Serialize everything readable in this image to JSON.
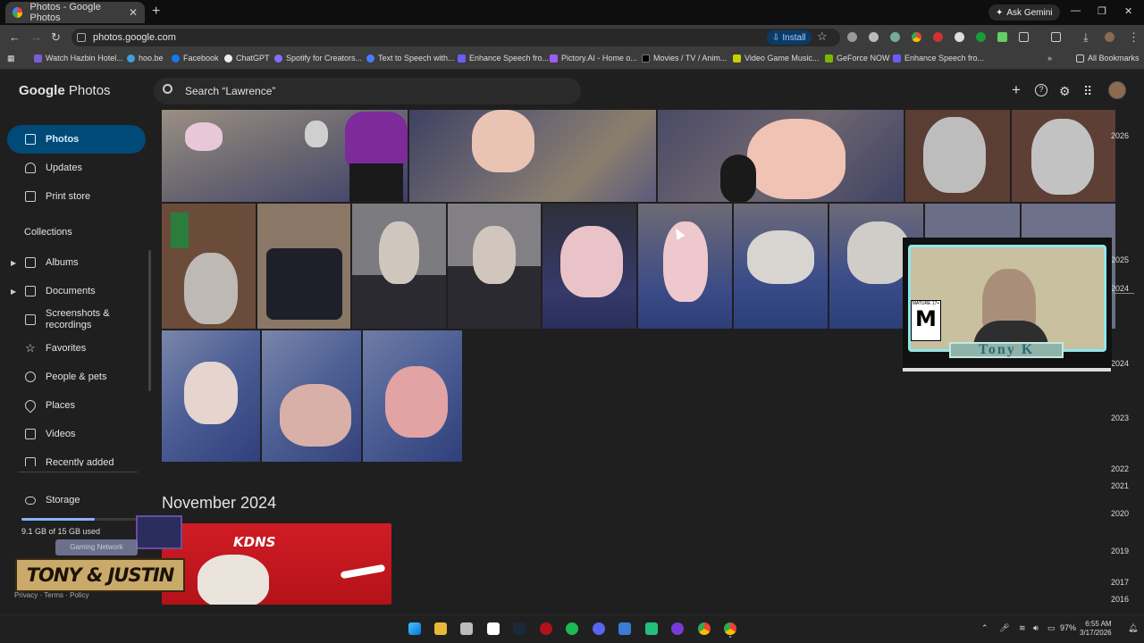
{
  "browser": {
    "tab_title": "Photos - Google Photos",
    "tab_close": "✕",
    "new_tab": "+",
    "ask_gemini": "Ask Gemini",
    "url": "photos.google.com",
    "install_label": "Install",
    "window_controls": [
      "—",
      "❐",
      "✕"
    ],
    "bookmarks": [
      {
        "label": "Watch Hazbin Hotel...",
        "color": "#7b5cd6"
      },
      {
        "label": "hoo.be",
        "color": "#3aa0e0"
      },
      {
        "label": "Facebook",
        "color": "#1877f2"
      },
      {
        "label": "ChatGPT",
        "color": "#ffffff"
      },
      {
        "label": "Spotify for Creators...",
        "color": "#8b6cff"
      },
      {
        "label": "Text to Speech with...",
        "color": "#4a7cff"
      },
      {
        "label": "Enhance Speech fro...",
        "color": "#6a5cff"
      },
      {
        "label": "Pictory.AI - Home o...",
        "color": "#9d5cff"
      },
      {
        "label": "Movies / TV / Anim...",
        "color": "#000000"
      },
      {
        "label": "Video Game Music...",
        "color": "#c8d000"
      },
      {
        "label": "GeForce NOW",
        "color": "#76b900"
      },
      {
        "label": "Enhance Speech fro...",
        "color": "#6a5cff"
      }
    ],
    "more_bookmarks": "»",
    "all_bookmarks": "All Bookmarks"
  },
  "app": {
    "logo_google": "Google",
    "logo_photos": "Photos",
    "search_placeholder": "Search “Lawrence”",
    "header_icons": [
      "plus-icon",
      "help-icon",
      "settings-icon",
      "apps-grid-icon"
    ]
  },
  "sidebar": {
    "items": [
      {
        "label": "Photos",
        "icon": "photos-icon"
      },
      {
        "label": "Updates",
        "icon": "bell-icon"
      },
      {
        "label": "Print store",
        "icon": "print-store-icon"
      }
    ],
    "collections_header": "Collections",
    "collections": [
      {
        "label": "Albums",
        "icon": "albums-icon"
      },
      {
        "label": "Documents",
        "icon": "documents-icon"
      },
      {
        "label": "Screenshots & recordings",
        "icon": "screenshots-icon"
      },
      {
        "label": "Favorites",
        "icon": "star-icon"
      },
      {
        "label": "People & pets",
        "icon": "people-pets-icon"
      },
      {
        "label": "Places",
        "icon": "places-icon"
      },
      {
        "label": "Videos",
        "icon": "videos-icon"
      },
      {
        "label": "Recently added",
        "icon": "recent-icon"
      }
    ],
    "storage_label": "Storage",
    "storage_used": "9.1 GB of 15 GB used",
    "storage_fraction": 0.61,
    "footer_privacy": "Privacy",
    "footer_sep": "·",
    "footer_terms": "Terms",
    "footer_policy": "Policy"
  },
  "timeline": {
    "years": [
      "2026",
      "2025",
      "2024",
      "2024",
      "2023",
      "2022",
      "2021",
      "2020",
      "2019",
      "2017",
      "2016"
    ],
    "section_title": "November 2024"
  },
  "overlays": {
    "webcam_name": "Tony K",
    "rating_top": "MATURE 17+",
    "rating_letter": "M",
    "banner_main": "TONY & JUSTIN",
    "banner_small": "Gaming Network"
  },
  "taskbar": {
    "time": "6:55 AM",
    "date": "3/17/2026",
    "battery": "97%"
  },
  "colors": {
    "accent": "#004a77",
    "background": "#1f1f1f",
    "webcam_border": "#8de7ea"
  }
}
